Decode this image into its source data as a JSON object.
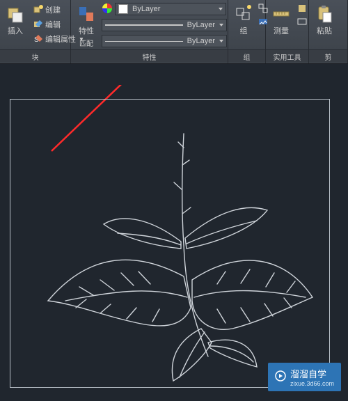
{
  "ribbon": {
    "block": {
      "insert_label": "插入",
      "create_label": "创建",
      "edit_label": "编辑",
      "edit_attr_label": "编辑属性",
      "title": "块"
    },
    "properties": {
      "match_label": "特性",
      "match_sub": "匹配",
      "color_value": "ByLayer",
      "linetype_value": "ByLayer",
      "lineweight_value": "ByLayer",
      "title": "特性"
    },
    "group": {
      "label": "组",
      "title": "组"
    },
    "measure": {
      "label": "测量",
      "title": "实用工具"
    },
    "paste": {
      "label": "粘贴",
      "title": "剪"
    }
  },
  "watermark": {
    "text": "溜溜自学",
    "url": "zixue.3d66.com"
  }
}
